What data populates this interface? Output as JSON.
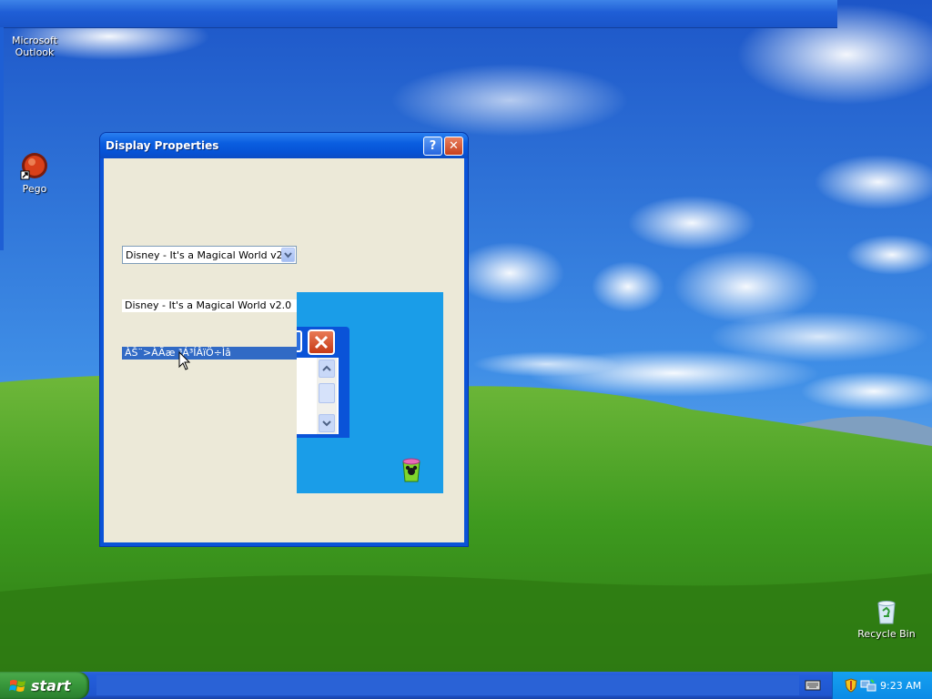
{
  "desktop": {
    "icons": [
      {
        "label_line1": "Microsoft",
        "label_line2": "Outlook",
        "icon": "outlook-icon"
      },
      {
        "label_line1": "Pego",
        "label_line2": "",
        "icon": "pego-icon"
      },
      {
        "label_line1": "Recycle Bin",
        "label_line2": "",
        "icon": "recycle-bin-icon"
      }
    ]
  },
  "window": {
    "title": "Display Properties",
    "help_label": "?",
    "close_label": "✕",
    "combo": {
      "selected": "Disney - It's a Magical World v2.0"
    },
    "list": {
      "items": [
        "Disney - It's a Magical World v2.0",
        "ÀŠ¨>ÀÃæ ³Á³ÍÂïÖ÷Ìâ"
      ],
      "selected_index": 1
    }
  },
  "taskbar": {
    "start_label": "start",
    "clock": "9:23 AM"
  },
  "colors": {
    "selection": "#316ac5",
    "title_bar": "#0a5ee0",
    "preview_background": "#1a9de8"
  }
}
